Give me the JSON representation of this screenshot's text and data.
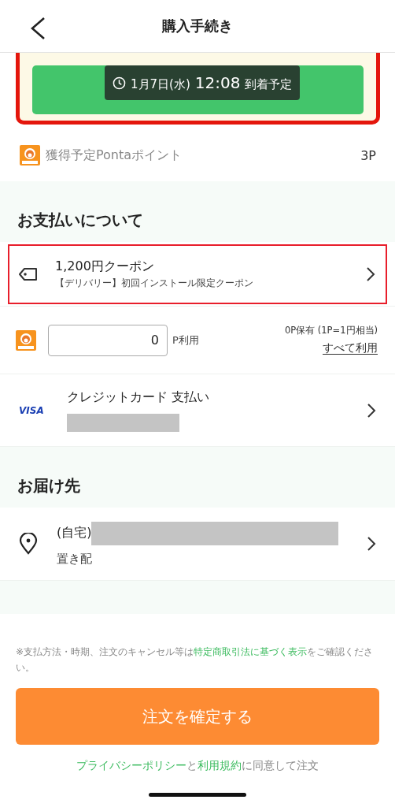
{
  "header": {
    "title": "購入手続き"
  },
  "banner": {
    "highlighted": true,
    "arrival": {
      "date": "1月7日(水)",
      "time": "12:08",
      "suffix": "到着予定"
    }
  },
  "ponta_points": {
    "label": "獲得予定Pontaポイント",
    "value": "3P"
  },
  "payment": {
    "heading": "お支払いについて",
    "coupon": {
      "highlighted": true,
      "title": "1,200円クーポン",
      "subtitle": "【デリバリー】初回インストール限定クーポン"
    },
    "points_use": {
      "value": "0",
      "unit": "P利用",
      "balance": "0P保有 (1P=1円相当)",
      "use_all": "すべて利用"
    },
    "card": {
      "brand": "VISA",
      "label": "クレジットカード 支払い"
    }
  },
  "delivery": {
    "heading": "お届け先",
    "address": {
      "label": "(自宅)",
      "note": "置き配"
    }
  },
  "legal_note": [
    {
      "kind": "text",
      "text": "※支払方法・時期、注文のキャンセル等は"
    },
    {
      "kind": "link",
      "text": "特定商取引法に基づく表示"
    },
    {
      "kind": "text",
      "text": "をご確認ください。"
    }
  ],
  "confirm_button": "注文を確定する",
  "agreement": [
    {
      "kind": "link",
      "text": "プライバシーポリシー"
    },
    {
      "kind": "text",
      "text": "と"
    },
    {
      "kind": "link",
      "text": "利用規約"
    },
    {
      "kind": "text",
      "text": "に同意して注文"
    }
  ]
}
